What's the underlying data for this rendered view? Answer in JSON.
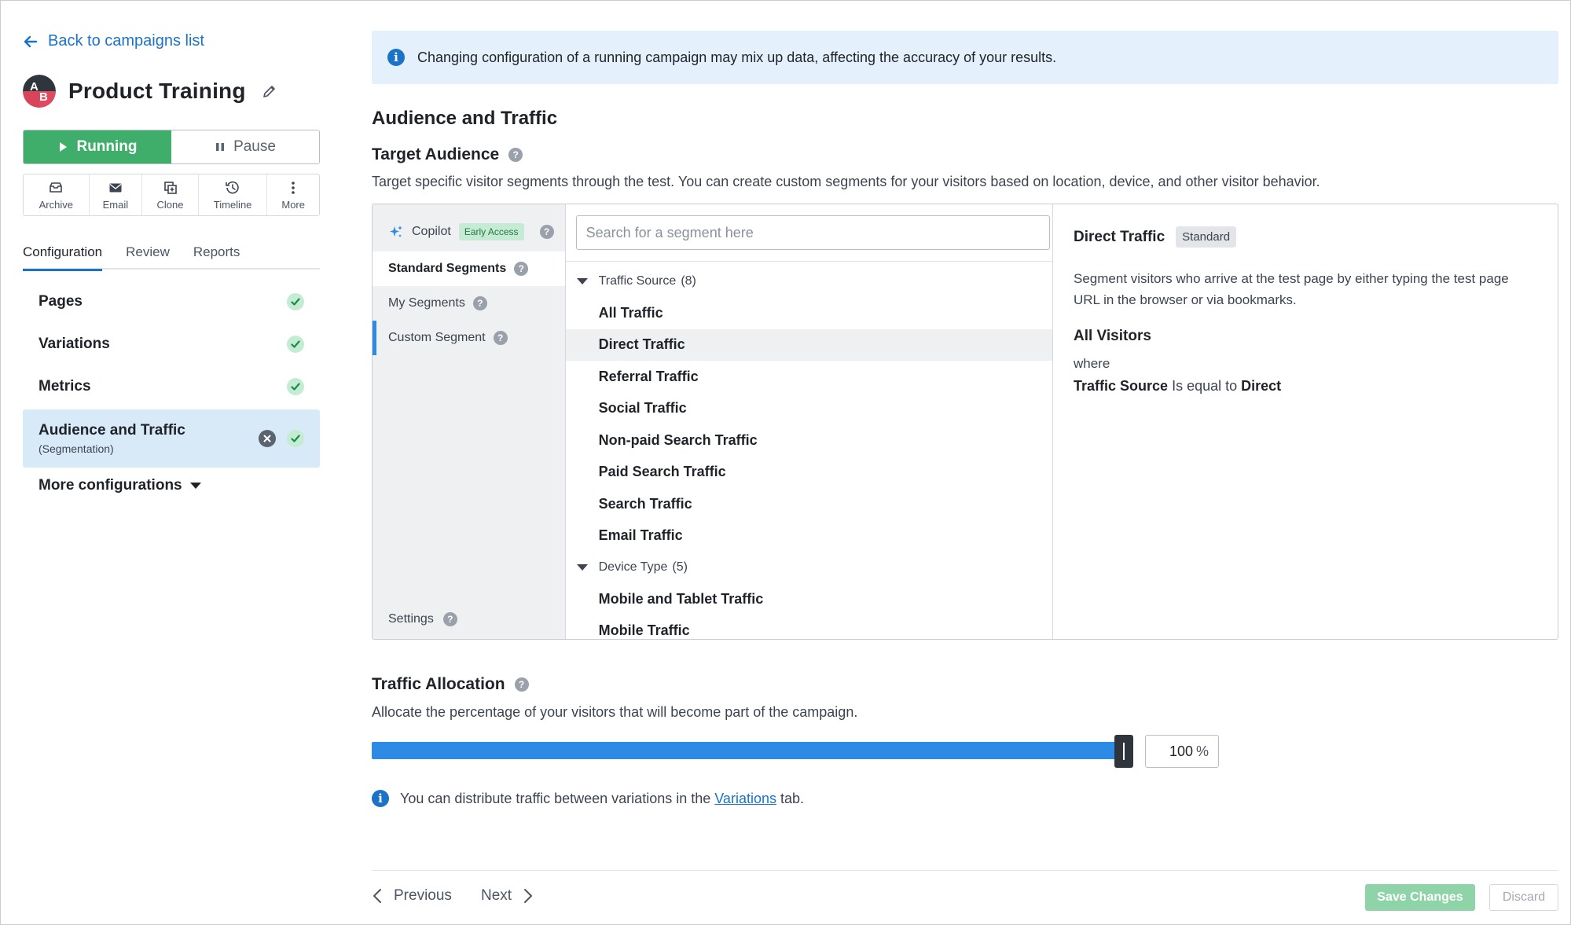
{
  "sidebar": {
    "back_label": "Back to campaigns list",
    "campaign_title": "Product Training",
    "status": {
      "running_label": "Running",
      "pause_label": "Pause"
    },
    "actions": [
      {
        "label": "Archive",
        "icon": "archive-icon"
      },
      {
        "label": "Email",
        "icon": "email-icon"
      },
      {
        "label": "Clone",
        "icon": "clone-icon"
      },
      {
        "label": "Timeline",
        "icon": "timeline-icon"
      },
      {
        "label": "More",
        "icon": "more-vertical-icon"
      }
    ],
    "tabs": [
      {
        "label": "Configuration",
        "active": true
      },
      {
        "label": "Review",
        "active": false
      },
      {
        "label": "Reports",
        "active": false
      }
    ],
    "config_items": [
      {
        "label": "Pages",
        "complete": true
      },
      {
        "label": "Variations",
        "complete": true
      },
      {
        "label": "Metrics",
        "complete": true
      },
      {
        "label": "Audience and Traffic",
        "sub": "(Segmentation)",
        "complete": true,
        "active": true
      }
    ],
    "more_configs_label": "More configurations"
  },
  "main": {
    "banner_text": "Changing configuration of a running campaign may mix up data, affecting the accuracy of your results.",
    "section_title": "Audience and Traffic",
    "target": {
      "title": "Target Audience",
      "description": "Target specific visitor segments through the test. You can create custom segments for your visitors based on location, device, and other visitor behavior."
    },
    "segment_nav": {
      "copilot_label": "Copilot",
      "copilot_badge": "Early Access",
      "items": [
        "Standard Segments",
        "My Segments",
        "Custom Segment"
      ],
      "settings_label": "Settings"
    },
    "segment_search": {
      "placeholder": "Search for a segment here",
      "value": ""
    },
    "groups": [
      {
        "name": "Traffic Source",
        "count": "(8)",
        "items": [
          "All Traffic",
          "Direct Traffic",
          "Referral Traffic",
          "Social Traffic",
          "Non-paid Search Traffic",
          "Paid Search Traffic",
          "Search Traffic",
          "Email Traffic"
        ]
      },
      {
        "name": "Device Type",
        "count": "(5)",
        "items": [
          "Mobile and Tablet Traffic",
          "Mobile Traffic"
        ]
      }
    ],
    "detail": {
      "title": "Direct Traffic",
      "badge": "Standard",
      "description": "Segment visitors who arrive at the test page by either typing the test page URL in the browser or via bookmarks.",
      "all_visitors": "All Visitors",
      "where": "where",
      "rule_field": "Traffic Source",
      "rule_op": "Is equal to",
      "rule_value": "Direct"
    },
    "traffic": {
      "title": "Traffic Allocation",
      "description": "Allocate the percentage of your visitors that will become part of the campaign.",
      "allocation_value": "100",
      "allocation_unit": "%",
      "allocation_fraction": 1.0,
      "note_before": "You can distribute traffic between variations in the",
      "note_link": "Variations",
      "note_after": "tab."
    },
    "footer": {
      "previous_label": "Previous",
      "next_label": "Next",
      "save_label": "Save Changes",
      "discard_label": "Discard"
    }
  },
  "colors": {
    "accent": "#1a73c9",
    "running": "#3fae6a",
    "slider": "#2d8be6",
    "banner_bg": "#e4f0fb",
    "active_item_bg": "#d8e9f8",
    "save_disabled": "#8fd3a8"
  }
}
